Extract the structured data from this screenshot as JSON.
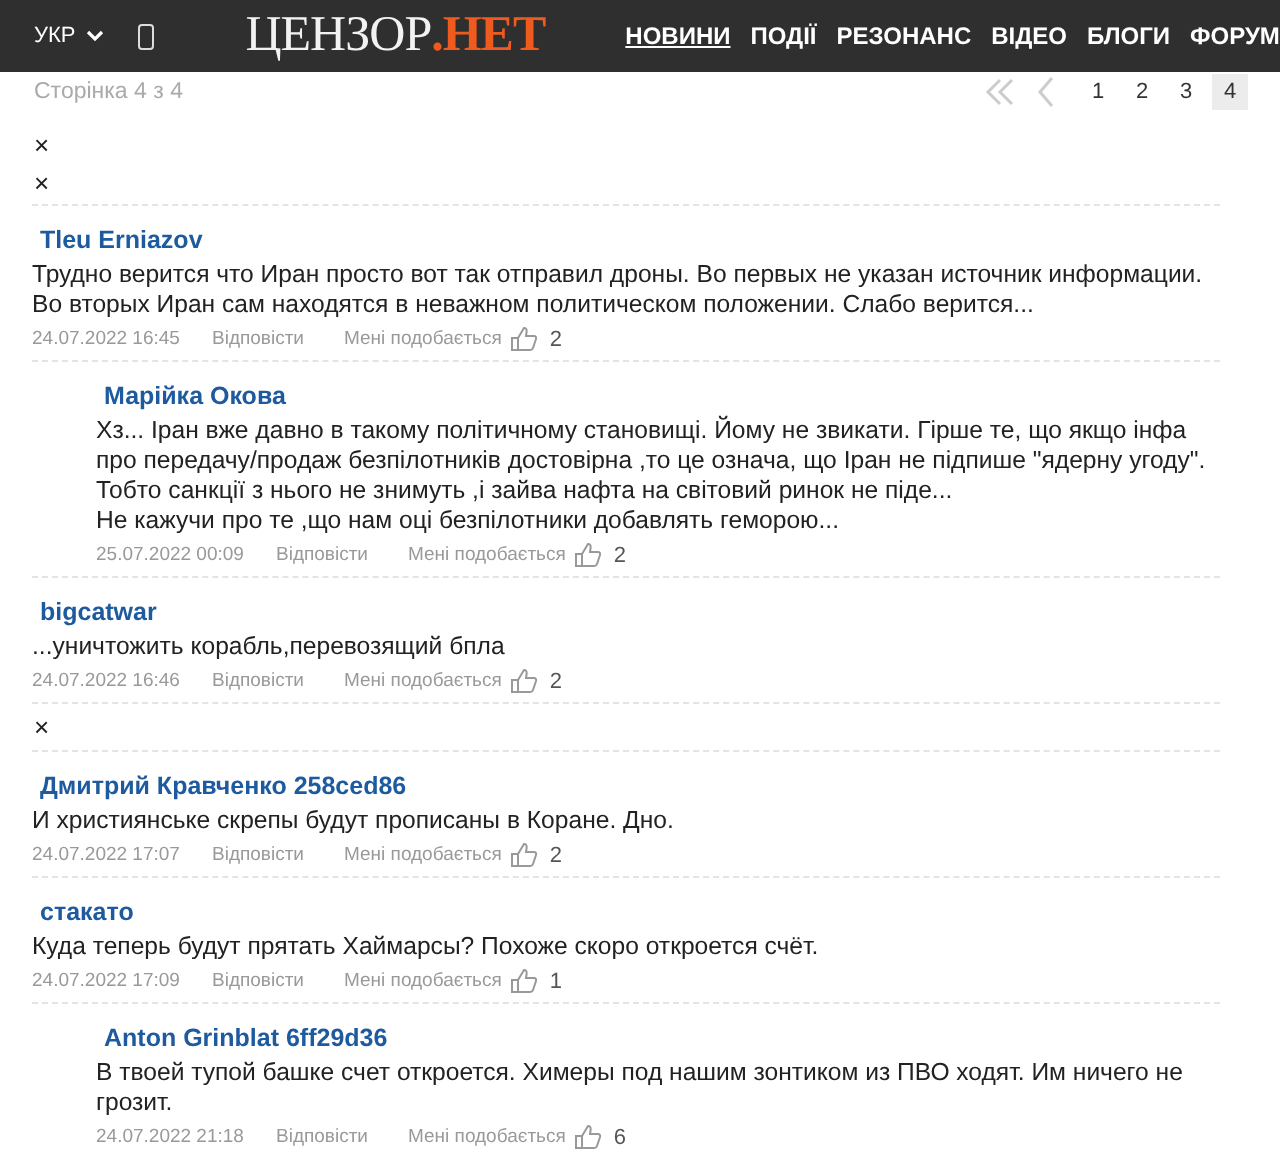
{
  "header": {
    "language": "УКР",
    "logo": {
      "main": "ЦЕНЗОР",
      "accent": ".НЕТ"
    },
    "nav": [
      {
        "label": "НОВИНИ",
        "selected": true
      },
      {
        "label": "ПОДІЇ",
        "selected": false
      },
      {
        "label": "РЕЗОНАНС",
        "selected": false
      },
      {
        "label": "ВІДЕО",
        "selected": false
      },
      {
        "label": "БЛОГИ",
        "selected": false
      },
      {
        "label": "ФОРУМ",
        "selected": false
      }
    ]
  },
  "page_info": "Сторінка 4 з 4",
  "pagination": [
    {
      "label": "1",
      "selected": false
    },
    {
      "label": "2",
      "selected": false
    },
    {
      "label": "3",
      "selected": false
    },
    {
      "label": "4",
      "selected": true
    }
  ],
  "dismiss_marks": [
    "×",
    "×"
  ],
  "comments": [
    {
      "kind": "comment",
      "reply": false,
      "author": "Tleu Erniazov",
      "text": "Трудно верится что Иран просто вот так отправил дроны. Во первых не указан источник информации.\nВо вторых Иран сам находятся в неважном политическом положении. Слабо верится...",
      "date": "24.07.2022 16:45",
      "reply_label": "Відповісти",
      "like_label": "Мені подобається",
      "likes": "2"
    },
    {
      "kind": "comment",
      "reply": true,
      "author": "Марійка Окова",
      "text": "Хз... Іран вже давно в такому політичному становищі. Йому не звикати. Гірше те, що якщо інфа\nпро передачу/продаж безпілотників достовірна ,то це означа, що Іран не підпише \"ядерну угоду\".\nТобто санкції з нього не знимуть ,і зайва нафта на світовий ринок не піде...\nНе кажучи про те ,що нам оці безпілотники добавлять геморою...",
      "date": "25.07.2022 00:09",
      "reply_label": "Відповісти",
      "like_label": "Мені подобається",
      "likes": "2"
    },
    {
      "kind": "comment",
      "reply": false,
      "author": "bigcatwar",
      "text": "...уничтожить корабль,перевозящий бпла",
      "date": "24.07.2022 16:46",
      "reply_label": "Відповісти",
      "like_label": "Мені подобається",
      "likes": "2"
    },
    {
      "kind": "hidden",
      "mark": "×"
    },
    {
      "kind": "comment",
      "reply": false,
      "author": "Дмитрий Кравченко 258ced86",
      "text": "И християнське скрепы будут прописаны в Коране. Дно.",
      "date": "24.07.2022 17:07",
      "reply_label": "Відповісти",
      "like_label": "Мені подобається",
      "likes": "2"
    },
    {
      "kind": "comment",
      "reply": false,
      "author": "стакато",
      "text": "Куда теперь будут прятать Хаймарсы? Похоже скоро откроется счёт.",
      "date": "24.07.2022 17:09",
      "reply_label": "Відповісти",
      "like_label": "Мені подобається",
      "likes": "1"
    },
    {
      "kind": "comment",
      "reply": true,
      "author": "Anton Grinblat 6ff29d36",
      "text": "В твоей тупой башке счет откроется. Химеры под нашим зонтиком из ПВО ходят. Им ничего не\nгрозит.",
      "date": "24.07.2022 21:18",
      "reply_label": "Відповісти",
      "like_label": "Мені подобається",
      "likes": "6"
    }
  ]
}
